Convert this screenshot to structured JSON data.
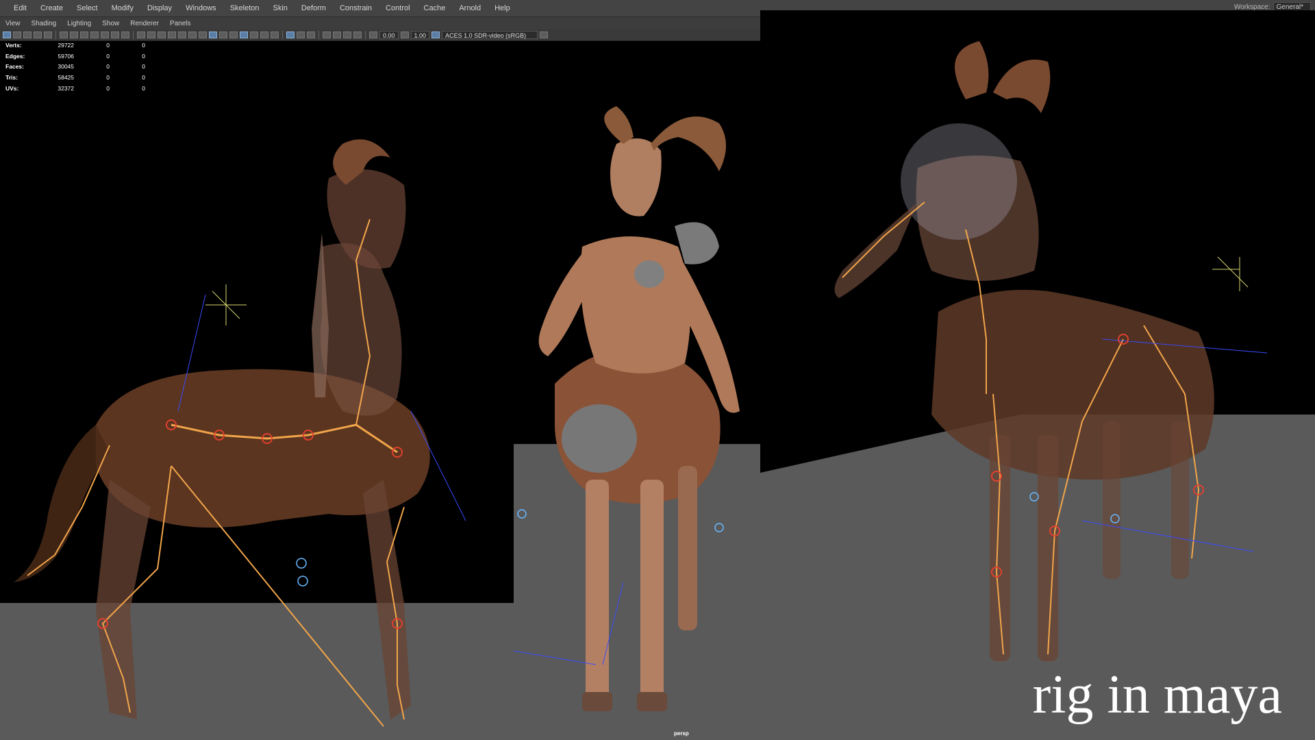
{
  "menubar": {
    "items": [
      "Edit",
      "Create",
      "Select",
      "Modify",
      "Display",
      "Windows",
      "Skeleton",
      "Skin",
      "Deform",
      "Constrain",
      "Control",
      "Cache",
      "Arnold",
      "Help"
    ],
    "workspace_label": "Workspace:",
    "workspace_value": "General*"
  },
  "panel_menu": {
    "items": [
      "View",
      "Shading",
      "Lighting",
      "Show",
      "Renderer",
      "Panels"
    ]
  },
  "toolbar": {
    "exposure": "0.00",
    "gamma": "1.00",
    "colorspace": "ACES 1.0 SDR-video (sRGB)"
  },
  "hud": {
    "rows": [
      {
        "label": "Verts:",
        "v1": "29722",
        "v2": "0",
        "v3": "0"
      },
      {
        "label": "Edges:",
        "v1": "59706",
        "v2": "0",
        "v3": "0"
      },
      {
        "label": "Faces:",
        "v1": "30045",
        "v2": "0",
        "v3": "0"
      },
      {
        "label": "Tris:",
        "v1": "58425",
        "v2": "0",
        "v3": "0"
      },
      {
        "label": "UVs:",
        "v1": "32372",
        "v2": "0",
        "v3": "0"
      }
    ]
  },
  "viewport": {
    "camera": "persp"
  },
  "caption": "rig in maya",
  "colors": {
    "joint": "#f2a54a",
    "joint_marker": "#e0402e",
    "axis": "#3a4bff",
    "ground": "#5a5a5a",
    "skin": "#b07a5a"
  }
}
